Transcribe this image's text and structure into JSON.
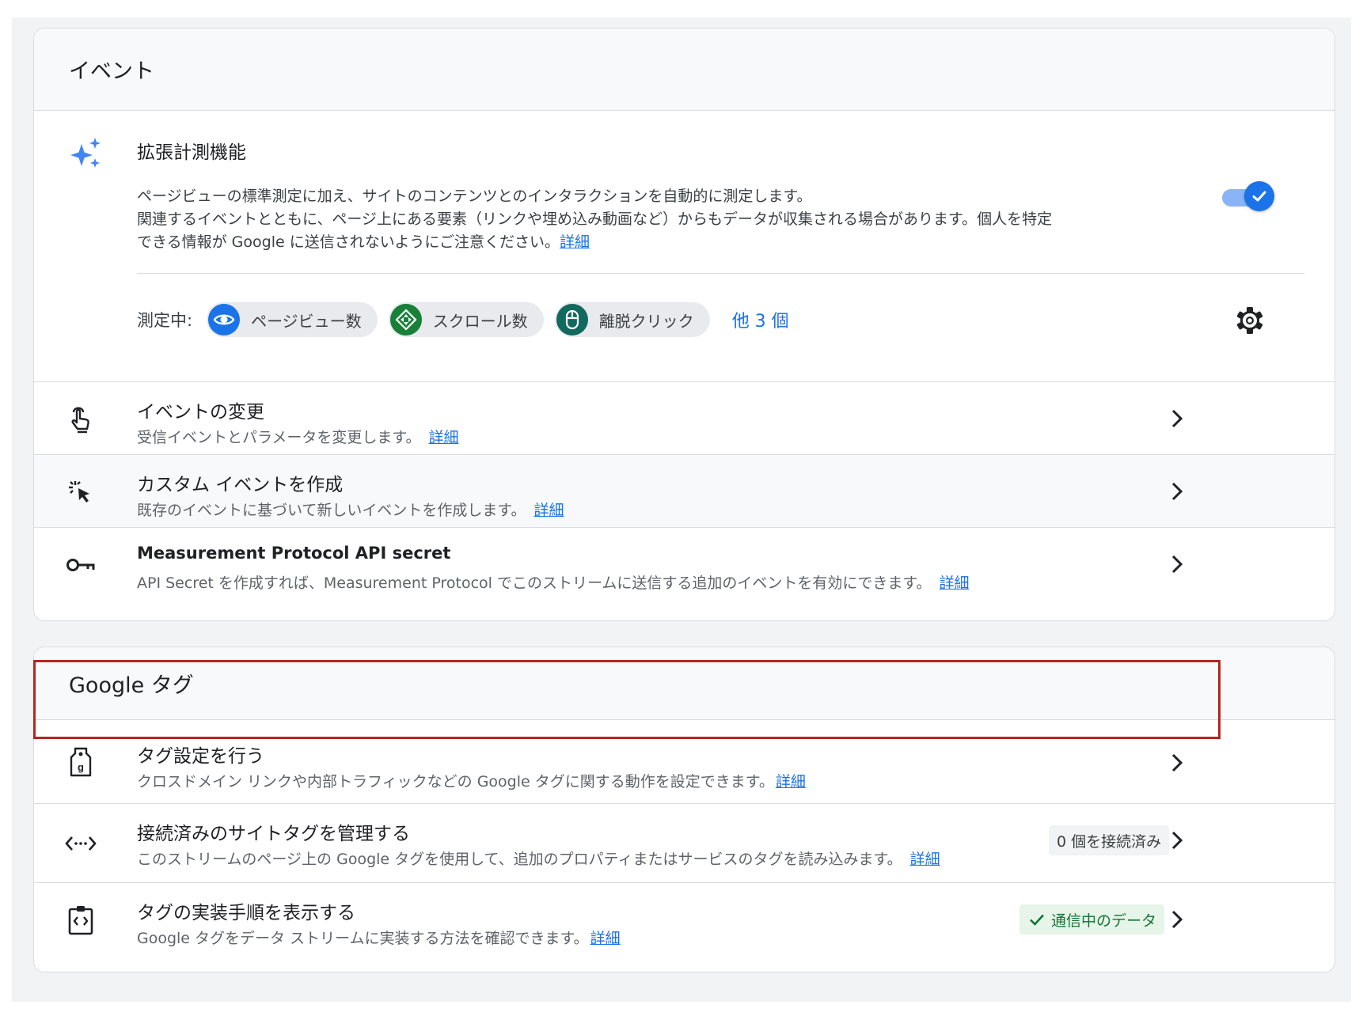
{
  "events_section": {
    "title": "イベント",
    "enhanced": {
      "title": "拡張計測機能",
      "desc_line1": "ページビューの標準測定に加え、サイトのコンテンツとのインタラクションを自動的に測定します。",
      "desc_line2": "関連するイベントとともに、ページ上にある要素（リンクや埋め込み動画など）からもデータが収集される場合があります。個人を特定",
      "desc_line3": "できる情報が Google に送信されないようにご注意ください。",
      "link": "詳細",
      "toggle_on": true,
      "measuring_label": "測定中:",
      "chips": [
        {
          "label": "ページビュー数",
          "icon": "eye-icon",
          "color": "#1a73e8"
        },
        {
          "label": "スクロール数",
          "icon": "scroll-arrows-icon",
          "color": "#188038"
        },
        {
          "label": "離脱クリック",
          "icon": "mouse-icon",
          "color": "#12695f"
        }
      ],
      "more": "他 3 個"
    },
    "rows": [
      {
        "title": "イベントの変更",
        "sub": "受信イベントとパラメータを変更します。",
        "link": "詳細"
      },
      {
        "title": "カスタム イベントを作成",
        "sub": "既存のイベントに基づいて新しいイベントを作成します。",
        "link": "詳細"
      },
      {
        "title": "Measurement Protocol API secret",
        "sub": "API Secret を作成すれば、Measurement Protocol でこのストリームに送信する追加のイベントを有効にできます。",
        "link": "詳細"
      }
    ]
  },
  "tags_section": {
    "title": "Google タグ",
    "rows": [
      {
        "title": "タグ設定を行う",
        "sub": "クロスドメイン リンクや内部トラフィックなどの Google タグに関する動作を設定できます。",
        "link": "詳細"
      },
      {
        "title": "接続済みのサイトタグを管理する",
        "sub": "このストリームのページ上の Google タグを使用して、追加のプロパティまたはサービスのタグを読み込みます。",
        "link": "詳細",
        "badge": "0 個を接続済み"
      },
      {
        "title": "タグの実装手順を表示する",
        "sub": "Google タグをデータ ストリームに実装する方法を確認できます。",
        "link": "詳細",
        "badge": "通信中のデータ"
      }
    ]
  },
  "colors": {
    "accent": "#1a73e8",
    "highlight": "#b3261e",
    "success": "#137333"
  }
}
